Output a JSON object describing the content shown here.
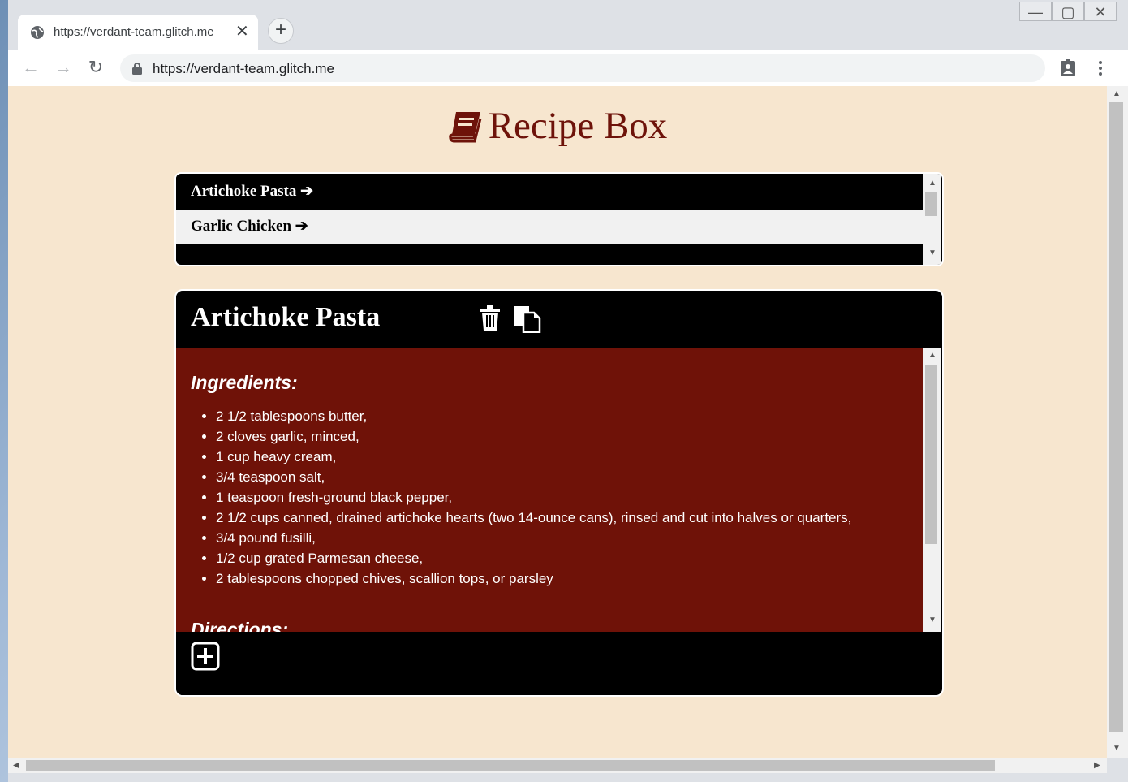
{
  "browser": {
    "tab_title": "https://verdant-team.glitch.me",
    "tab_close": "✕",
    "new_tab": "+",
    "url": "https://verdant-team.glitch.me",
    "back": "←",
    "forward": "→",
    "reload": "↻",
    "window_controls": {
      "minimize": "—",
      "maximize": "▢",
      "close": "✕"
    }
  },
  "app": {
    "title": "Recipe Box",
    "colors": {
      "background": "#f7e6cf",
      "accent": "#6e130a",
      "card": "#000000",
      "body": "#6f1208"
    }
  },
  "recipe_list": [
    {
      "name": "Artichoke Pasta",
      "arrow": "➔"
    },
    {
      "name": "Garlic Chicken",
      "arrow": "➔"
    }
  ],
  "recipe": {
    "title": "Artichoke Pasta",
    "ingredients_heading": "Ingredients:",
    "ingredients": [
      "2 1/2 tablespoons butter,",
      "2 cloves garlic, minced,",
      "1 cup heavy cream,",
      "3/4 teaspoon salt,",
      "1 teaspoon fresh-ground black pepper,",
      "2 1/2 cups canned, drained artichoke hearts (two 14-ounce cans), rinsed and cut into halves or quarters,",
      "3/4 pound fusilli,",
      "1/2 cup grated Parmesan cheese,",
      "2 tablespoons chopped chives, scallion tops, or parsley"
    ],
    "directions_heading": "Directions:"
  },
  "icons": {
    "delete": "trash-icon",
    "copy": "copy-icon",
    "add": "plus-square-icon",
    "title": "book-icon"
  }
}
